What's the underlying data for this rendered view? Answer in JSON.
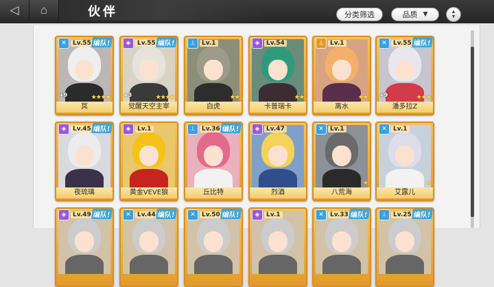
{
  "topbar": {
    "back_icon": "back-arrow-icon",
    "home_icon": "home-icon",
    "title": "伙伴",
    "filter_label": "分类筛选",
    "sort_label": "品质",
    "order_icon": "sort-order-icon"
  },
  "colors": {
    "team_badge": "#3da7e0",
    "card_gold": "#f5c45c",
    "topbar": "#2c2c2c"
  },
  "heroes": [
    {
      "level": "Lv.55",
      "team": "编队!",
      "name": "冥",
      "plus": "+9",
      "stars": 4,
      "class_icon": "sword-icon",
      "class_color": "#3aa0dc",
      "hair": "#efefef",
      "body": "#2b2b2b",
      "bg": "#bcb6b6"
    },
    {
      "level": "Lv.55",
      "team": "编队!",
      "name": "觉醒天空主宰",
      "plus": "+3",
      "stars": 4,
      "class_icon": "shield-icon",
      "class_color": "#9a57d6",
      "hair": "#e6e3dc",
      "body": "#3a3a3a",
      "bg": "#d9d3c6"
    },
    {
      "level": "Lv.1",
      "team": "",
      "name": "白虎",
      "plus": "",
      "stars": 2,
      "class_icon": "staff-icon",
      "class_color": "#3aa0dc",
      "hair": "#9c9a88",
      "body": "#2d2d2d",
      "bg": "#8c8f78"
    },
    {
      "level": "Lv.54",
      "team": "",
      "name": "卡普瑞卡",
      "plus": "",
      "stars": 2,
      "class_icon": "shield-icon",
      "class_color": "#9a57d6",
      "hair": "#2f9a7c",
      "body": "#3c2d35",
      "bg": "#6a8c7c"
    },
    {
      "level": "Lv.1",
      "team": "",
      "name": "离水",
      "plus": "",
      "stars": 2,
      "class_icon": "staff-icon",
      "class_color": "#e29a2c",
      "hair": "#f2b06a",
      "body": "#5a2d4a",
      "bg": "#d8a383"
    },
    {
      "level": "Lv.55",
      "team": "编队!",
      "name": "潘多拉Z",
      "plus": "+9",
      "stars": 3,
      "class_icon": "sword-icon",
      "class_color": "#3aa0dc",
      "hair": "#e8e6ef",
      "body": "#d33a4a",
      "bg": "#c7c5cf"
    },
    {
      "level": "Lv.45",
      "team": "编队!",
      "name": "夜琉璃",
      "plus": "",
      "stars": 0,
      "class_icon": "shield-icon",
      "class_color": "#9a57d6",
      "hair": "#ececec",
      "body": "#3a3248",
      "bg": "#d9d9e2"
    },
    {
      "level": "Lv.1",
      "team": "",
      "name": "黄金VEVE狼",
      "plus": "",
      "stars": 0,
      "class_icon": "shield-icon",
      "class_color": "#9a57d6",
      "hair": "#f5c21a",
      "body": "#c8241f",
      "bg": "#e9c76c"
    },
    {
      "level": "Lv.36",
      "team": "编队!",
      "name": "丘比特",
      "plus": "",
      "stars": 0,
      "class_icon": "staff-icon",
      "class_color": "#3aa0dc",
      "hair": "#e26a8a",
      "body": "#f2f2f2",
      "bg": "#e9b0bd"
    },
    {
      "level": "Lv.47",
      "team": "",
      "name": "烈酒",
      "plus": "",
      "stars": 0,
      "class_icon": "shield-icon",
      "class_color": "#9a57d6",
      "hair": "#f3d35a",
      "body": "#2f4f8a",
      "bg": "#7fa0c8"
    },
    {
      "level": "Lv.1",
      "team": "",
      "name": "八荒海",
      "plus": "",
      "stars": 1,
      "class_icon": "sword-icon",
      "class_color": "#3aa0dc",
      "hair": "#6a6a6a",
      "body": "#2a2a2a",
      "bg": "#8c9097"
    },
    {
      "level": "Lv.1",
      "team": "",
      "name": "艾露儿",
      "plus": "",
      "stars": 1,
      "class_icon": "sword-icon",
      "class_color": "#3aa0dc",
      "hair": "#dcdcea",
      "body": "#f2f2f2",
      "bg": "#c7d1de"
    },
    {
      "level": "Lv.49",
      "team": "编队!",
      "name": "",
      "plus": "",
      "stars": 0,
      "class_icon": "shield-icon",
      "class_color": "#9a57d6",
      "hair": "#cccccc",
      "body": "#666",
      "bg": "#d2c2a8"
    },
    {
      "level": "Lv.44",
      "team": "编队!",
      "name": "",
      "plus": "",
      "stars": 0,
      "class_icon": "sword-icon",
      "class_color": "#3aa0dc",
      "hair": "#cccccc",
      "body": "#666",
      "bg": "#d2c2a8"
    },
    {
      "level": "Lv.50",
      "team": "编队!",
      "name": "",
      "plus": "",
      "stars": 0,
      "class_icon": "sword-icon",
      "class_color": "#3aa0dc",
      "hair": "#cccccc",
      "body": "#666",
      "bg": "#d2c2a8"
    },
    {
      "level": "Lv.1",
      "team": "",
      "name": "",
      "plus": "",
      "stars": 0,
      "class_icon": "shield-icon",
      "class_color": "#9a57d6",
      "hair": "#cccccc",
      "body": "#666",
      "bg": "#d2c2a8"
    },
    {
      "level": "Lv.33",
      "team": "编队!",
      "name": "",
      "plus": "",
      "stars": 0,
      "class_icon": "sword-icon",
      "class_color": "#3aa0dc",
      "hair": "#cccccc",
      "body": "#666",
      "bg": "#d2c2a8"
    },
    {
      "level": "Lv.25",
      "team": "编队!",
      "name": "",
      "plus": "",
      "stars": 0,
      "class_icon": "staff-icon",
      "class_color": "#3aa0dc",
      "hair": "#cccccc",
      "body": "#666",
      "bg": "#d2c2a8"
    }
  ]
}
